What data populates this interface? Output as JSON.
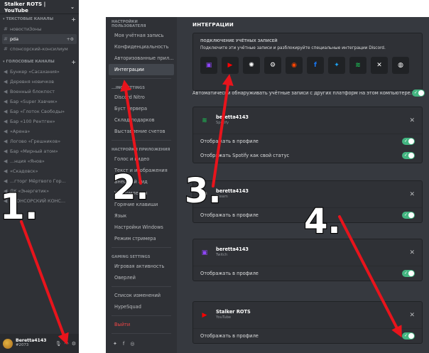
{
  "server": {
    "name": "Stalker ROTS | YouTube"
  },
  "text_category": {
    "label": "ТЕКСТОВЫЕ КАНАЛЫ"
  },
  "text_channels": [
    {
      "label": "новостиЗоны",
      "icon": "hash-icon"
    },
    {
      "label": "pda",
      "icon": "hash-icon",
      "active": true
    },
    {
      "label": "спонсорский-консилиум",
      "icon": "hash-icon"
    }
  ],
  "voice_category": {
    "label": "ГОЛОСОВЫЕ КАНАЛЫ"
  },
  "voice_channels": [
    {
      "label": "Бункер «Сасахания»"
    },
    {
      "label": "Деревня новичков"
    },
    {
      "label": "Военный блокпост"
    },
    {
      "label": "Бар «Super Хавчик»"
    },
    {
      "label": "Бар «Глоток Свободы»"
    },
    {
      "label": "Бар «100 Рентген»"
    },
    {
      "label": "«Арена»"
    },
    {
      "label": "Логово «Грешников»"
    },
    {
      "label": "Бар «Мирный атом»"
    },
    {
      "label": "...нция «Янов»"
    },
    {
      "label": "«Скадовск»"
    },
    {
      "label": "...гторг Мёртвого Гор..."
    },
    {
      "label": "ДК «Энергетик»"
    },
    {
      "label": "СПОНСОРСКИЙ КОНС..."
    }
  ],
  "user": {
    "name": "Beretta4143",
    "tag": "#2073"
  },
  "settings_nav": {
    "user_section": "НАСТРОЙКИ ПОЛЬЗОВАТЕЛЯ",
    "user_items": [
      "Моя учётная запись",
      "Конфиденциальность",
      "Авторизованные прил...",
      "Интеграции"
    ],
    "billing_section": "...ING SETTINGS",
    "billing_items": [
      "Discord Nitro",
      "Буст сервера",
      "Склад подарков",
      "Выставление счетов"
    ],
    "app_section": "НАСТРОЙКИ ПРИЛОЖЕНИЯ",
    "app_items": [
      "Голос и видео",
      "Текст и изображения",
      "Внешний вид",
      "Уведомления",
      "Горячие клавиши",
      "Язык",
      "Настройки Windows",
      "Режим стримера"
    ],
    "gaming_section": "GAMING SETTINGS",
    "gaming_items": [
      "Игровая активность",
      "Оверлей"
    ],
    "misc_items": [
      "Список изменений",
      "HypeSquad"
    ],
    "logout": "Выйти"
  },
  "integrations": {
    "title": "ИНТЕГРАЦИИ",
    "connect_title": "ПОДКЛЮЧЕНИЕ УЧЁТНЫХ ЗАПИСЕЙ",
    "connect_desc": "Подключите эти учётные записи и разблокируйте специальные интеграции Discord.",
    "providers": [
      {
        "icon": "twitch-icon",
        "glyph": "▣"
      },
      {
        "icon": "youtube-icon",
        "glyph": "▶"
      },
      {
        "icon": "battlenet-icon",
        "glyph": "✺"
      },
      {
        "icon": "steam-icon",
        "glyph": "⚙"
      },
      {
        "icon": "reddit-icon",
        "glyph": "◉"
      },
      {
        "icon": "facebook-icon",
        "glyph": "f"
      },
      {
        "icon": "twitter-icon",
        "glyph": "✦"
      },
      {
        "icon": "spotify-icon",
        "glyph": "≋"
      },
      {
        "icon": "xbox-icon",
        "glyph": "✕"
      },
      {
        "icon": "github-icon",
        "glyph": "◍"
      }
    ],
    "autodetect_label": "Автоматически обнаруживать учётные записи с других платформ на этом компьютере.",
    "autodetect_on": true
  },
  "accounts": [
    {
      "name": "beretta4143",
      "type": "Spotify",
      "icon": "spotify-icon",
      "color": "#1db954",
      "options": [
        {
          "label": "Отображать в профиле",
          "on": true
        },
        {
          "label": "Отображать Spotify как свой статус",
          "on": true
        }
      ]
    },
    {
      "name": "beretta4143",
      "type": "Steam",
      "icon": "steam-icon",
      "color": "#ffffff",
      "options": [
        {
          "label": "Отображать в профиле",
          "on": true
        }
      ]
    },
    {
      "name": "beretta4143",
      "type": "Twitch",
      "icon": "twitch-icon",
      "color": "#9146ff",
      "options": [
        {
          "label": "Отображать в профиле",
          "on": true
        }
      ]
    },
    {
      "name": "Stalker ROTS",
      "type": "YouTube",
      "icon": "youtube-icon",
      "color": "#ff0000",
      "options": [
        {
          "label": "Отображать в профиле",
          "on": true
        }
      ]
    }
  ],
  "annotations": {
    "steps": [
      "1.",
      "2.",
      "3.",
      "4."
    ],
    "color": "#e8141c"
  }
}
